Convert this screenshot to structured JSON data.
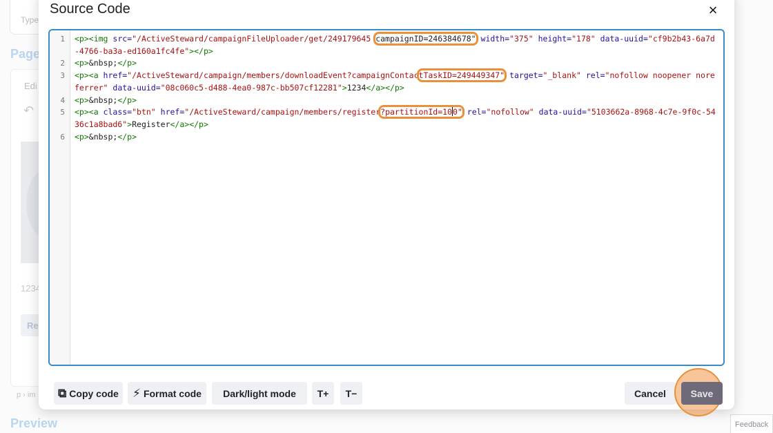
{
  "background": {
    "type_label": "Type",
    "page_heading": "Page",
    "edit_label": "Edi",
    "undo_icon": "undo-icon",
    "number_text": "1234",
    "button_label": "Re",
    "path_text": "p › im",
    "preview_heading": "Preview",
    "feedback_label": "Feedback"
  },
  "modal": {
    "title": "Source Code",
    "close_icon": "×",
    "accent_color": "#3a8ac4",
    "highlight_color": "#e8913a"
  },
  "code": {
    "lines": [
      {
        "number": "1"
      },
      {
        "number": "2"
      },
      {
        "number": "3"
      },
      {
        "number": "4"
      },
      {
        "number": "5"
      },
      {
        "number": "6"
      }
    ],
    "line1": {
      "t1": "<p><img ",
      "a1": "src=",
      "s1": "\"/ActiveSteward/campaignFileUploader/get/249179645 ",
      "h1": "campaignID=246384678\"",
      "a2": " width=",
      "s2": "\"375\"",
      "a3": " height=",
      "s3": "\"178\"",
      "a4": " data-uuid=",
      "s4": "\"cf9b2b43-6a7d-4766-ba3a-ed160a1fc4fe\"",
      "t2": "></p>"
    },
    "line2": {
      "t1": "<p>",
      "e1": "&nbsp;",
      "t2": "</p>"
    },
    "line3": {
      "t1": "<p><a ",
      "a1": "href=",
      "s1": "\"/ActiveSteward/campaign/members/downloadEvent?campaignContac",
      "h1": "tTaskID=249449347\"",
      "a2": " target=",
      "s2": "\"_blank\"",
      "a3": " rel=",
      "s3": "\"nofollow noopener noreferrer\"",
      "a4": " data-uuid=",
      "s4": "\"08c060c5-d488-4ea0-987c-bb507cf12281\"",
      "t2": ">",
      "p1": "1234",
      "t3": "</a></p>"
    },
    "line4": {
      "t1": "<p>",
      "e1": "&nbsp;",
      "t2": "</p>"
    },
    "line5": {
      "t1": "<p><a ",
      "a1": "class=",
      "s1": "\"btn\"",
      "a2": " href=",
      "s2": "\"/ActiveSteward/campaign/members/register",
      "h1a": "?partitionId=10",
      "h1b": "0\"",
      "a3": " rel=",
      "s3": "\"nofollow\"",
      "a4": " data-uuid=",
      "s4": "\"5103662a-8968-4c7e-9f0c-5436c1a8bad6\"",
      "t2": ">",
      "p1": "Register",
      "t3": "</a></p>"
    },
    "line6": {
      "t1": "<p>",
      "e1": "&nbsp;",
      "t2": "</p>"
    }
  },
  "toolbar": {
    "copy_icon": "⧉",
    "copy_label": "Copy code",
    "format_icon": "⚡",
    "format_label": "Format code",
    "mode_label": "Dark/light mode",
    "tplus_label": "T+",
    "tminus_label": "T−",
    "cancel_label": "Cancel",
    "save_label": "Save"
  }
}
